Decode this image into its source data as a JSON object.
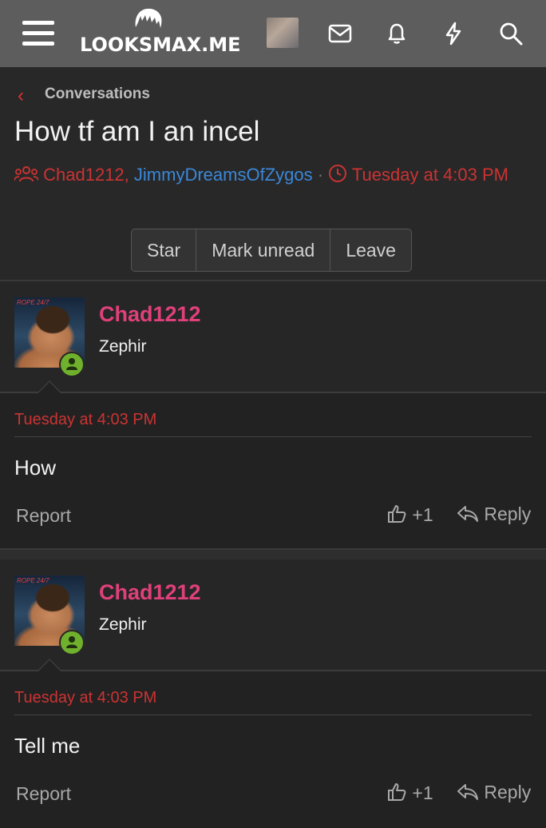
{
  "topbar": {
    "logo_text": "LOOKSMAX.ME",
    "icons": [
      "menu-icon",
      "logo-hair-icon",
      "user-avatar",
      "mail-icon",
      "bell-icon",
      "lightning-icon",
      "search-icon"
    ]
  },
  "breadcrumb": {
    "label": "Conversations"
  },
  "conversation": {
    "title": "How tf am I an incel",
    "participant_1": "Chad1212",
    "separator": ",",
    "participant_2": "JimmyDreamsOfZygos",
    "dot": "·",
    "timestamp_part1": "Tuesday at 4:03",
    "timestamp_part2": "PM"
  },
  "actions": {
    "star": "Star",
    "mark_unread": "Mark unread",
    "leave": "Leave"
  },
  "colors": {
    "accent_red": "#cc3333",
    "username_pink": "#e0407a",
    "link_blue": "#3a88d8",
    "online_green": "#6fb02c"
  },
  "posts": [
    {
      "username": "Chad1212",
      "user_title": "Zephir",
      "avatar_tag": "ROPE 24/7",
      "time": "Tuesday at 4:03 PM",
      "text": "How",
      "report_label": "Report",
      "like_label": "+1",
      "reply_label": "Reply"
    },
    {
      "username": "Chad1212",
      "user_title": "Zephir",
      "avatar_tag": "ROPE 24/7",
      "time": "Tuesday at 4:03 PM",
      "text": "Tell me",
      "report_label": "Report",
      "like_label": "+1",
      "reply_label": "Reply"
    }
  ]
}
